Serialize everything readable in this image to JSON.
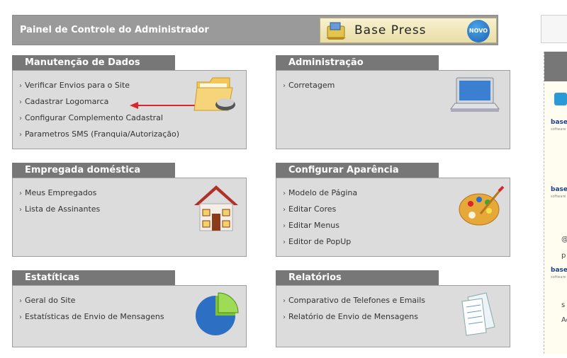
{
  "header": {
    "title": "Painel de Controle do Administrador",
    "brand": "Base Press",
    "brand_badge": "NOVO"
  },
  "panels": {
    "dados": {
      "title": "Manutenção de Dados",
      "items": [
        "Verificar Envios para o Site",
        "Cadastrar Logomarca",
        "Configurar Complemento Cadastral",
        "Parametros SMS (Franquia/Autorização)"
      ],
      "icon": "folder-mouse-icon"
    },
    "admin": {
      "title": "Administração",
      "items": [
        "Corretagem"
      ],
      "icon": "laptop-icon"
    },
    "empregada": {
      "title": "Empregada doméstica",
      "items": [
        "Meus Empregados",
        "Lista de Assinantes"
      ],
      "icon": "house-icon"
    },
    "aparencia": {
      "title": "Configurar Aparência",
      "items": [
        "Modelo de Página",
        "Editar Cores",
        "Editar Menus",
        "Editor de PopUp"
      ],
      "icon": "palette-icon"
    },
    "estat": {
      "title": "Estatíticas",
      "items": [
        "Geral do Site",
        "Estatísticas de Envio de Mensagens"
      ],
      "icon": "pie-chart-icon"
    },
    "relat": {
      "title": "Relatórios",
      "items": [
        "Comparativo de Telefones e Emails",
        "Relatório de Envio de Mensagens"
      ],
      "icon": "documents-icon"
    }
  },
  "sidebar": {
    "logo_text": "base",
    "logo_sub": "software",
    "snippets": [
      "@",
      "p",
      "s",
      "Ac"
    ]
  },
  "colors": {
    "tab": "#777777",
    "panel_bg": "#dcdcdc",
    "arrow": "#d9262c"
  }
}
